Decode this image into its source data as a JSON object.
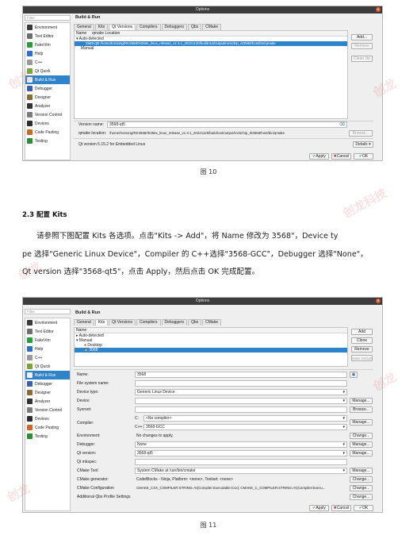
{
  "fig10": {
    "title": "Options",
    "filter_placeholder": "Filter",
    "sidebar": [
      {
        "label": "Environment",
        "icon": "monitor-icon",
        "color": "#3a3a3a"
      },
      {
        "label": "Text Editor",
        "icon": "text-editor-icon",
        "color": "#6e6e6e"
      },
      {
        "label": "FakeVim",
        "icon": "fakevim-icon",
        "color": "#2f9a3a"
      },
      {
        "label": "Help",
        "icon": "help-icon",
        "color": "#2c6fc4"
      },
      {
        "label": "C++",
        "icon": "cpp-icon",
        "color": "#9a9a9a"
      },
      {
        "label": "Qt Quick",
        "icon": "qt-quick-icon",
        "color": "#7aa33a"
      },
      {
        "label": "Build & Run",
        "icon": "build-run-icon",
        "color": "#f0f0f0"
      },
      {
        "label": "Debugger",
        "icon": "debugger-icon",
        "color": "#3b5fa8"
      },
      {
        "label": "Designer",
        "icon": "designer-icon",
        "color": "#8a6a3a"
      },
      {
        "label": "Analyzer",
        "icon": "analyzer-icon",
        "color": "#333333"
      },
      {
        "label": "Version Control",
        "icon": "version-control-icon",
        "color": "#7c7c7c"
      },
      {
        "label": "Devices",
        "icon": "devices-icon",
        "color": "#2c2c2c"
      },
      {
        "label": "Code Pasting",
        "icon": "code-pasting-icon",
        "color": "#c56a2a"
      },
      {
        "label": "Testing",
        "icon": "testing-icon",
        "color": "#2f8a3a"
      }
    ],
    "selected_index": 6,
    "panel_title": "Build & Run",
    "tabs": [
      "General",
      "Kits",
      "Qt Versions",
      "Compilers",
      "Debuggers",
      "Qbs",
      "CMake"
    ],
    "active_tab": 2,
    "col_name": "Name",
    "col_location": "qmake Location",
    "tree_auto": "Auto-detected",
    "tree_selected": "3568-qt5 /home/troniong/RK3568/rk356x_linux_release_v1.3.1_20221120/buildroot/output/rockchip_rk3568/host/bin/qmake",
    "tree_manual": "Manual",
    "buttons": [
      "Add...",
      "Remove",
      "Clean Up"
    ],
    "version_name_label": "Version name:",
    "version_name_value": "3568-qt5",
    "qmake_label": "qmake location:",
    "qmake_value": "/home/troniong/RK3568/rk356x_linux_release_v1.3.1_20221120/buildroot/output/rockchip_rk3568/host/bin/qmake",
    "browse": "Browse...",
    "qt_info": "Qt version 5.15.2 for Embedded Linux",
    "details": "Details",
    "apply": "Apply",
    "cancel": "Cancel",
    "ok": "OK"
  },
  "caption10": "图 10",
  "heading": "2.3 配置 Kits",
  "para_lines": [
    "请参照下图配置 Kits 各选项。点击\"Kits -> Add\"，将 Name 修改为 3568\"，Device ty",
    "pe 选择\"Generic Linux Device\"，Compiler 的 C++选择\"3568-GCC\"，Debugger 选择\"None\"，",
    "Qt version 选择\"3568-qt5\"，点击 Apply，然后点击 OK 完成配置。"
  ],
  "fig11": {
    "title": "Options",
    "filter_placeholder": "Filter",
    "panel_title": "Build & Run",
    "tabs": [
      "General",
      "Kits",
      "Qt Versions",
      "Compilers",
      "Debuggers",
      "Qbs",
      "CMake"
    ],
    "active_tab": 1,
    "col_name": "Name",
    "tree_auto": "Auto-detected",
    "tree_manual": "Manual",
    "tree_desktop": "Desktop",
    "tree_selected": "3568",
    "buttons": [
      "Add",
      "Clone",
      "Remove",
      "Make Default"
    ],
    "fields": {
      "name_label": "Name:",
      "name_value": "3568",
      "fs_label": "File system name:",
      "device_type_label": "Device type:",
      "device_type_value": "Generic Linux Device",
      "device_label": "Device:",
      "sysroot_label": "Sysroot:",
      "compiler_label": "Compiler:",
      "c_label": "C:",
      "c_value": "<No compiler>",
      "cpp_label": "C++:",
      "cpp_value": "3568-GCC",
      "environment_label": "Environment:",
      "environment_value": "No changes to apply.",
      "debugger_label": "Debugger:",
      "debugger_value": "None",
      "qtversion_label": "Qt version:",
      "qtversion_value": "3568-qt5",
      "mkspec_label": "Qt mkspec:",
      "cmake_tool_label": "CMake Tool:",
      "cmake_tool_value": "System CMake at /usr/bin/cmake",
      "cmake_gen_label": "CMake generator:",
      "cmake_gen_value": "CodeBlocks - Ninja, Platform: <none>, Toolset: <none>",
      "cmake_conf_label": "CMake Configuration",
      "cmake_conf_value": "CMAKE_CXX_COMPILER:STRING=%{Compiler:Executable:Cxx}; CMAKE_C_COMPILER:STRING=%{Compiler:Execu...",
      "qbs_label": "Additional Qbs Profile Settings"
    },
    "manage": "Manage...",
    "browse": "Browse...",
    "change": "Change...",
    "apply": "Apply",
    "cancel": "Cancel",
    "ok": "OK"
  },
  "caption11": "图 11"
}
